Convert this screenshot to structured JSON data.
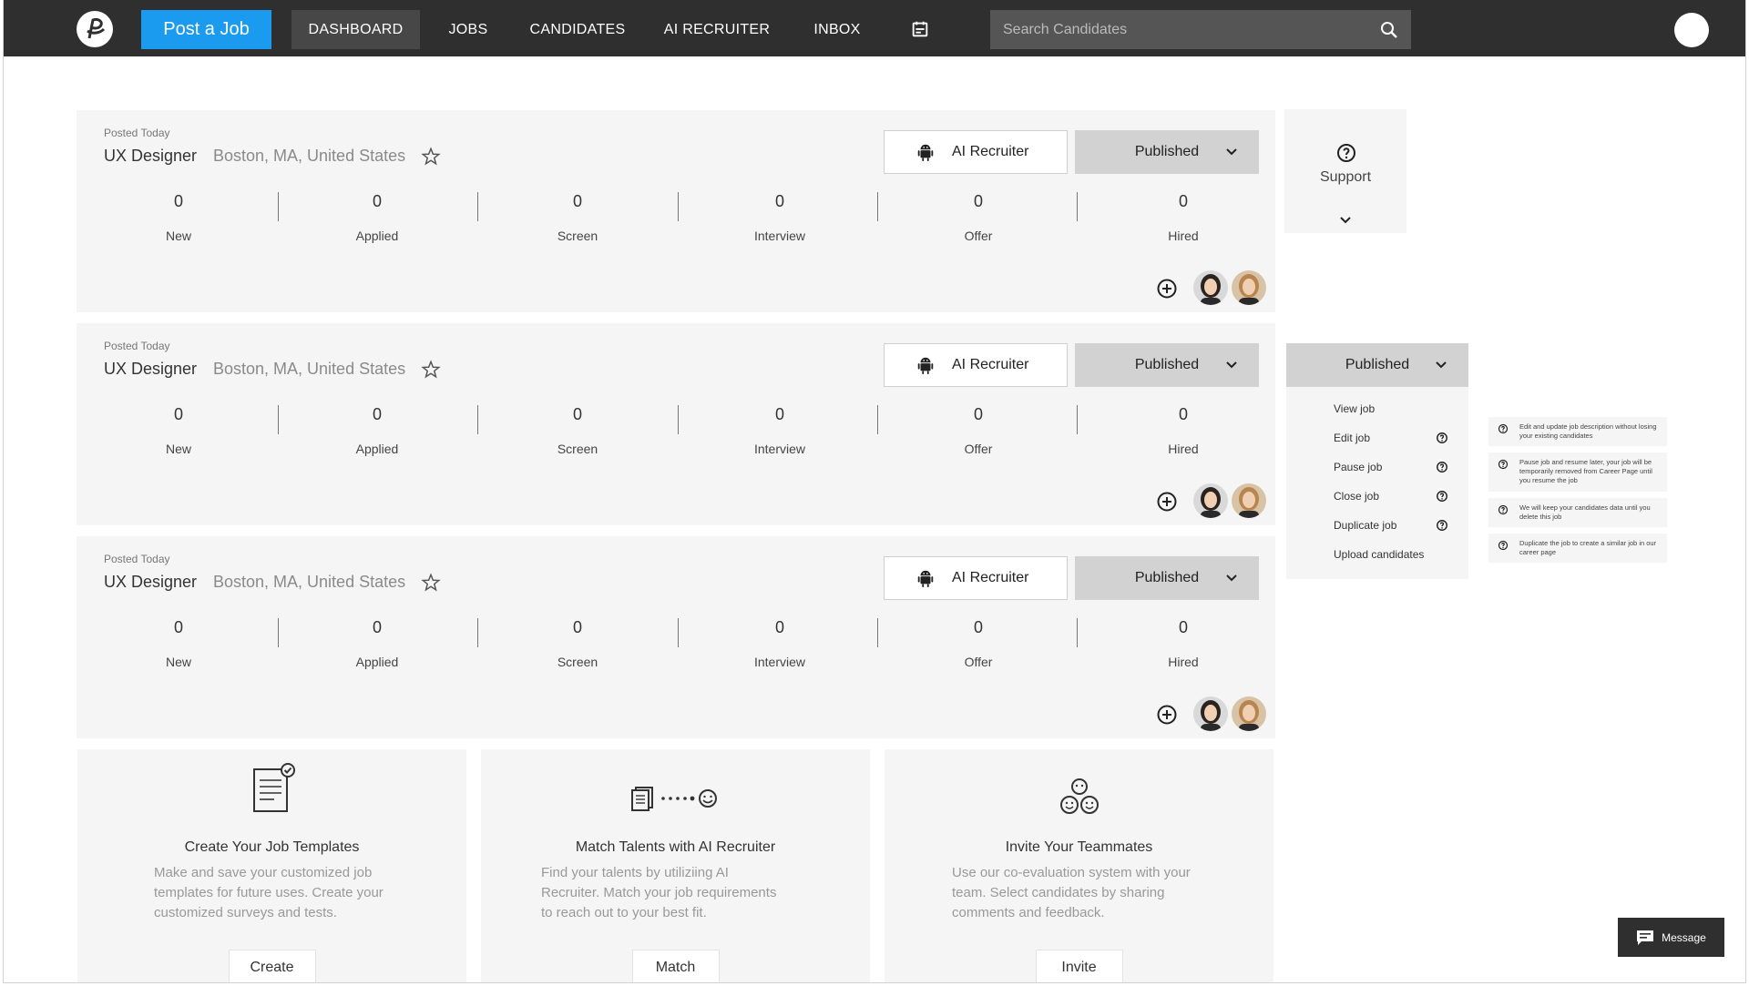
{
  "nav": {
    "post_job": "Post a Job",
    "items": [
      "DASHBOARD",
      "JOBS",
      "CANDIDATES",
      "AI RECRUITER",
      "INBOX"
    ],
    "search_placeholder": "Search Candidates"
  },
  "jobs": [
    {
      "posted": "Posted Today",
      "title": "UX Designer",
      "location": "Boston, MA, United States",
      "ai_label": "AI Recruiter",
      "status": "Published",
      "stats": [
        {
          "value": "0",
          "label": "New"
        },
        {
          "value": "0",
          "label": "Applied"
        },
        {
          "value": "0",
          "label": "Screen"
        },
        {
          "value": "0",
          "label": "Interview"
        },
        {
          "value": "0",
          "label": "Offer"
        },
        {
          "value": "0",
          "label": "Hired"
        }
      ]
    },
    {
      "posted": "Posted Today",
      "title": "UX Designer",
      "location": "Boston, MA, United States",
      "ai_label": "AI Recruiter",
      "status": "Published",
      "stats": [
        {
          "value": "0",
          "label": "New"
        },
        {
          "value": "0",
          "label": "Applied"
        },
        {
          "value": "0",
          "label": "Screen"
        },
        {
          "value": "0",
          "label": "Interview"
        },
        {
          "value": "0",
          "label": "Offer"
        },
        {
          "value": "0",
          "label": "Hired"
        }
      ]
    },
    {
      "posted": "Posted Today",
      "title": "UX Designer",
      "location": "Boston, MA, United States",
      "ai_label": "AI Recruiter",
      "status": "Published",
      "stats": [
        {
          "value": "0",
          "label": "New"
        },
        {
          "value": "0",
          "label": "Applied"
        },
        {
          "value": "0",
          "label": "Screen"
        },
        {
          "value": "0",
          "label": "Interview"
        },
        {
          "value": "0",
          "label": "Offer"
        },
        {
          "value": "0",
          "label": "Hired"
        }
      ]
    }
  ],
  "support": {
    "label": "Support"
  },
  "dropdown": {
    "selected": "Published",
    "items": [
      "View job",
      "Edit job",
      "Pause job",
      "Close job",
      "Duplicate job",
      "Upload candidates"
    ],
    "tips": [
      "Edit and update job description without losing your existing candidates",
      "Pause job and resume later, your job will be temporarily removed from Career Page until you resume the job",
      "We will keep your candidates data until you delete this job",
      "Duplicate the job to create a similar job in our career page"
    ]
  },
  "promos": [
    {
      "title": "Create Your Job Templates",
      "desc": "Make and save your customized job templates for future uses. Create your customized surveys and tests.",
      "action": "Create"
    },
    {
      "title": "Match Talents with AI Recruiter",
      "desc": "Find your talents by utiliziing AI Recruiter. Match your job requirements to reach out to your best fit.",
      "action": "Match"
    },
    {
      "title": "Invite Your Teammates",
      "desc": "Use our co-evaluation system with your team. Select candidates by sharing comments and feedback.",
      "action": "Invite"
    }
  ],
  "message_label": "Message"
}
